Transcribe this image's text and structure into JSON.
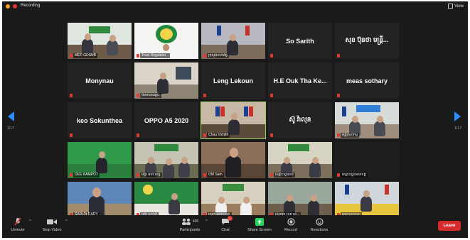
{
  "topbar": {
    "recording_label": "Recording",
    "view_label": "View"
  },
  "pager": {
    "left": "1/17",
    "right": "1/17"
  },
  "tiles": [
    {
      "label": "MEF-GDSNB",
      "name": ""
    },
    {
      "label": "Trust Regulator...",
      "name": ""
    },
    {
      "label": "ក្រសួងមហាផ្ទៃ",
      "name": ""
    },
    {
      "label": "",
      "name": "So Sarith"
    },
    {
      "label": "",
      "name": "សុខ ប៊ុនថា មន្ត្រី..."
    },
    {
      "label": "",
      "name": "Monynau"
    },
    {
      "label": "មិនមានឈ្មោះ",
      "name": ""
    },
    {
      "label": "",
      "name": "Leng Lekoun"
    },
    {
      "label": "",
      "name": "H.E Ouk Tha Ke..."
    },
    {
      "label": "",
      "name": "meas sothary"
    },
    {
      "label": "",
      "name": "keo Sokunthea"
    },
    {
      "label": "",
      "name": "OPPO A5 2020"
    },
    {
      "label": "Chau Vichith",
      "name": ""
    },
    {
      "label": "",
      "name": "ស៊ូ វ៉ាលុន"
    },
    {
      "label": "មន្ទីរកសិកម្ម",
      "name": ""
    },
    {
      "label": "DEE KAMPOT",
      "name": ""
    },
    {
      "label": "មន្ទីរ អប់រំ ខេត្ត",
      "name": ""
    },
    {
      "label": "OM Sam",
      "name": ""
    },
    {
      "label": "ឈ្មោះរដ្ឋបាល",
      "name": ""
    },
    {
      "label": "ឈ្មោះរដ្ឋបាលខេត្ត",
      "name": ""
    },
    {
      "label": "SARUN RADY",
      "name": ""
    },
    {
      "label": "មន្ទីរ សុខាភិ",
      "name": ""
    },
    {
      "label": "ឈ្មោះរដ្ឋបាលខេ",
      "name": ""
    },
    {
      "label": "រដ្ឋបាល ខេត្ត ស...",
      "name": ""
    },
    {
      "label": "ឈ្មោះរដ្ឋបាល",
      "name": ""
    }
  ],
  "toolbar": {
    "unmute": "Unmute",
    "stop_video": "Stop Video",
    "participants": "Participants",
    "participants_count": "406",
    "chat": "Chat",
    "chat_badge": "1",
    "share_screen": "Share Screen",
    "record": "Record",
    "reactions": "Reactions",
    "leave": "Leave"
  },
  "colors": {
    "accent_blue": "#2d8cff",
    "share_green": "#23d959",
    "leave_red": "#d62b2b",
    "active_outline": "#9bd26b"
  }
}
